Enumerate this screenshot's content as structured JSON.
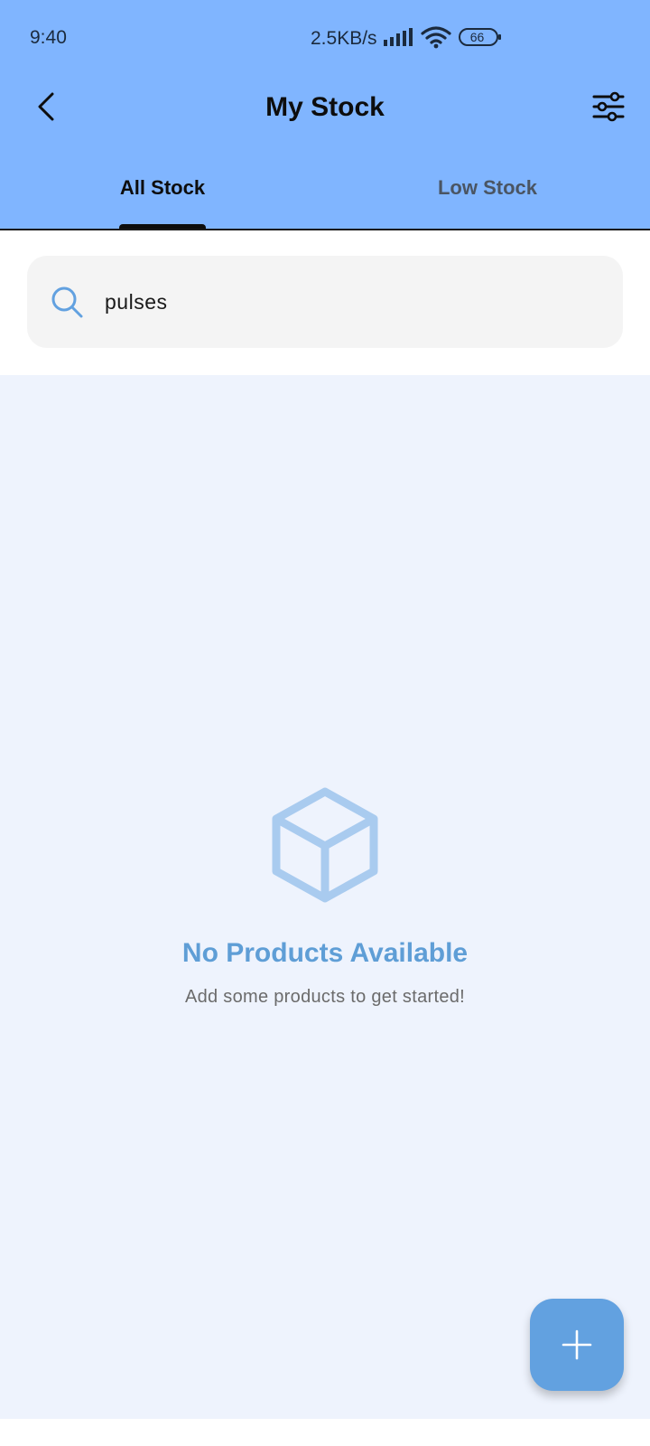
{
  "status_bar": {
    "time": "9:40",
    "net_speed": "2.5KB/s",
    "battery": "66"
  },
  "appbar": {
    "title": "My Stock",
    "back_icon": "chevron-left-icon",
    "filter_icon": "sliders-icon"
  },
  "tabs": [
    {
      "label": "All Stock",
      "active": true
    },
    {
      "label": "Low Stock",
      "active": false
    }
  ],
  "search": {
    "value": "pulses",
    "icon": "search-icon"
  },
  "empty_state": {
    "icon": "box-icon",
    "title": "No Products Available",
    "subtitle": "Add some products to get started!"
  },
  "fab": {
    "icon": "plus-icon"
  },
  "colors": {
    "header_bg": "#80b5ff",
    "content_bg": "#eef3fd",
    "accent": "#62a1e0",
    "empty_title": "#5f9ed6"
  }
}
